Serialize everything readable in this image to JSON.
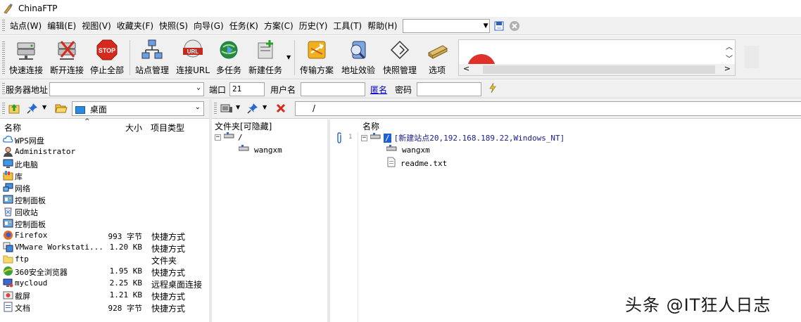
{
  "window": {
    "title": "ChinaFTP"
  },
  "menu": {
    "items": [
      "站点(W)",
      "编辑(E)",
      "视图(V)",
      "收藏夹(F)",
      "快照(S)",
      "向导(G)",
      "任务(K)",
      "方案(C)",
      "历史(Y)",
      "工具(T)",
      "帮助(H)"
    ],
    "combo_value": ""
  },
  "toolbar": {
    "buttons": [
      "快速连接",
      "断开连接",
      "停止全部",
      "站点管理",
      "连接URL",
      "多任务",
      "新建任务",
      "传输方案",
      "地址效验",
      "快照管理",
      "选项"
    ],
    "url_badge": "URL"
  },
  "connection": {
    "server_label": "服务器地址",
    "server_value": "",
    "port_label": "端口",
    "port_value": "21",
    "user_label": "用户名",
    "user_value": "",
    "anon_label": "匿名",
    "password_label": "密码",
    "password_value": ""
  },
  "local": {
    "path": "桌面",
    "columns": {
      "name": "名称",
      "size": "大小",
      "type": "项目类型"
    },
    "rows": [
      {
        "name": "WPS网盘",
        "size": "",
        "type": "",
        "icon": "cloud-icon"
      },
      {
        "name": "Administrator",
        "size": "",
        "type": "",
        "icon": "user-icon"
      },
      {
        "name": "此电脑",
        "size": "",
        "type": "",
        "icon": "computer-icon"
      },
      {
        "name": "库",
        "size": "",
        "type": "",
        "icon": "library-icon"
      },
      {
        "name": "网络",
        "size": "",
        "type": "",
        "icon": "network-icon"
      },
      {
        "name": "控制面板",
        "size": "",
        "type": "",
        "icon": "control-panel-icon"
      },
      {
        "name": "回收站",
        "size": "",
        "type": "",
        "icon": "recycle-bin-icon"
      },
      {
        "name": "控制面板",
        "size": "",
        "type": "",
        "icon": "control-panel-icon"
      },
      {
        "name": "Firefox",
        "size": "993 字节",
        "type": "快捷方式",
        "icon": "firefox-icon"
      },
      {
        "name": "VMware Workstati...",
        "size": "1.20 KB",
        "type": "快捷方式",
        "icon": "vmware-icon"
      },
      {
        "name": "ftp",
        "size": "",
        "type": "文件夹",
        "icon": "folder-icon"
      },
      {
        "name": "360安全浏览器",
        "size": "1.95 KB",
        "type": "快捷方式",
        "icon": "browser-icon"
      },
      {
        "name": "mycloud",
        "size": "2.25 KB",
        "type": "远程桌面连接",
        "icon": "remote-desktop-icon"
      },
      {
        "name": "截屏",
        "size": "1.21 KB",
        "type": "快捷方式",
        "icon": "screenshot-icon"
      },
      {
        "name": "文档",
        "size": "928 字节",
        "type": "快捷方式",
        "icon": "document-icon"
      }
    ]
  },
  "remote": {
    "path": "/",
    "folder_tree_header": "文件夹[可隐藏]",
    "folder_tree": {
      "root": "/",
      "child": "wangxm"
    },
    "list_header": "名称",
    "line_number": "1",
    "site_node": "[新建站点20,192.168.189.22,Windows_NT]",
    "site_root": "/",
    "children": [
      "wangxm",
      "readme.txt"
    ]
  },
  "watermark": "头条 @IT狂人日志",
  "colors": {
    "accent": "#1e5fd6",
    "link": "#0000cc",
    "stop_red": "#d62a1e"
  }
}
